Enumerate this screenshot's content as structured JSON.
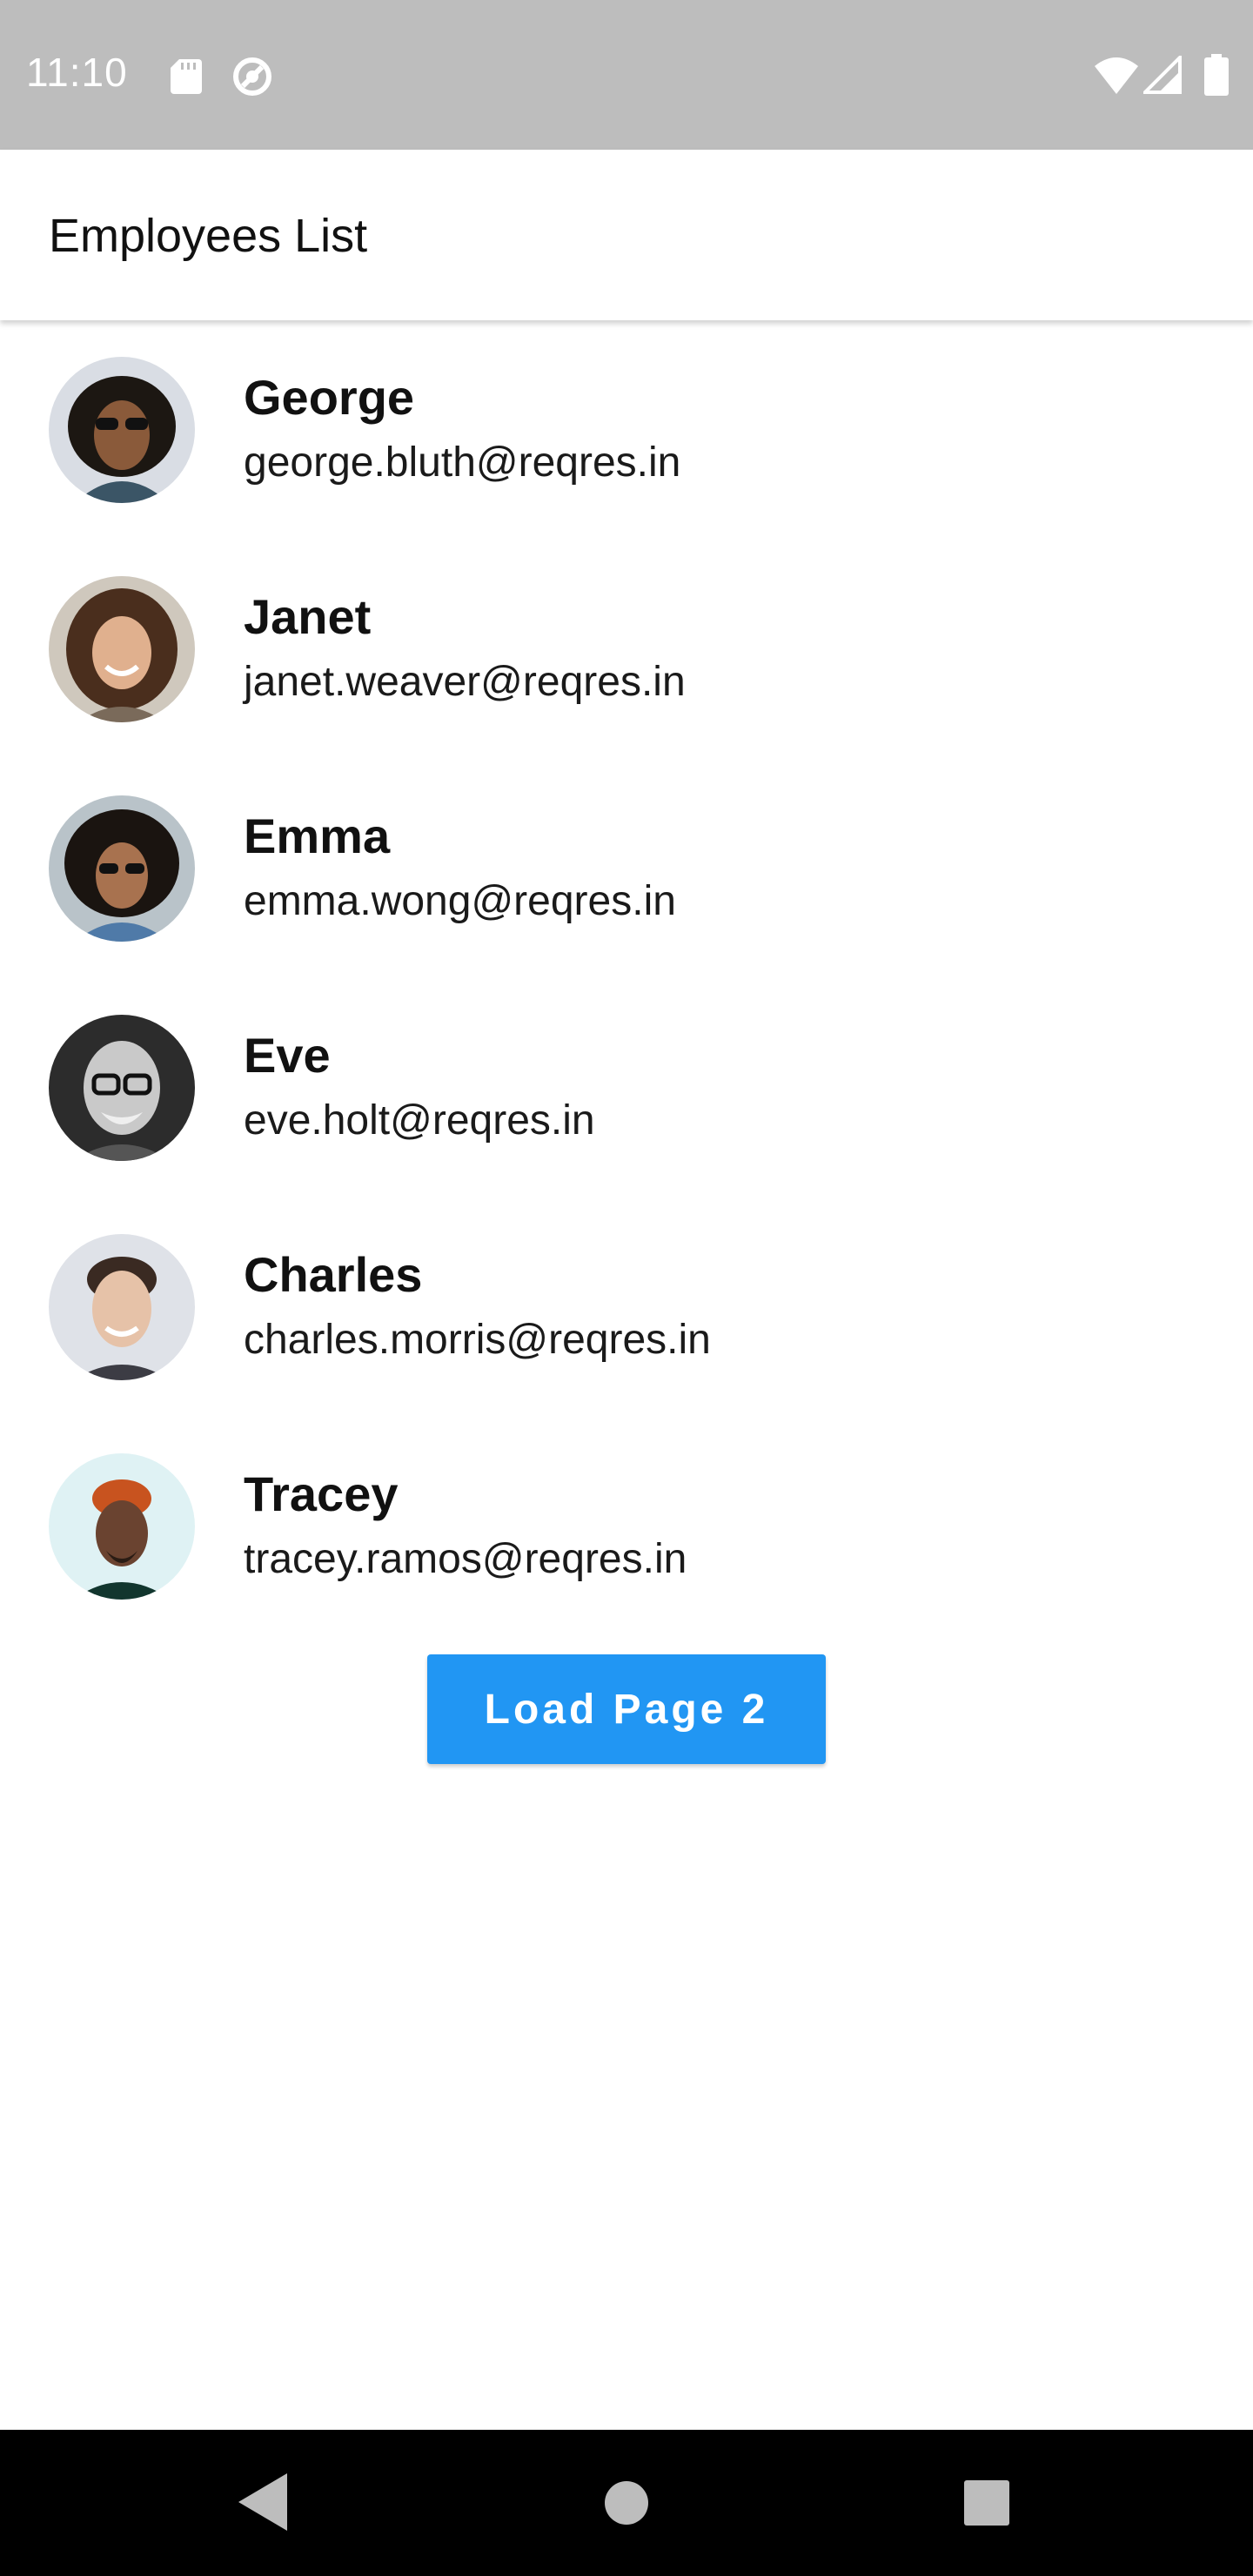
{
  "status_bar": {
    "time": "11:10",
    "icons": [
      "sd-card-icon",
      "sync-icon",
      "wifi-icon",
      "signal-icon",
      "battery-icon"
    ]
  },
  "app_bar": {
    "title": "Employees List"
  },
  "employees": [
    {
      "name": "George",
      "email": "george.bluth@reqres.in"
    },
    {
      "name": "Janet",
      "email": "janet.weaver@reqres.in"
    },
    {
      "name": "Emma",
      "email": "emma.wong@reqres.in"
    },
    {
      "name": "Eve",
      "email": "eve.holt@reqres.in"
    },
    {
      "name": "Charles",
      "email": "charles.morris@reqres.in"
    },
    {
      "name": "Tracey",
      "email": "tracey.ramos@reqres.in"
    }
  ],
  "load_button": {
    "label": "Load Page 2"
  },
  "nav_bar": {
    "icons": [
      "back-icon",
      "home-icon",
      "recents-icon"
    ]
  },
  "colors": {
    "status_bar": "#bdbdbd",
    "accent": "#2196f3",
    "nav_bar": "#000000"
  }
}
